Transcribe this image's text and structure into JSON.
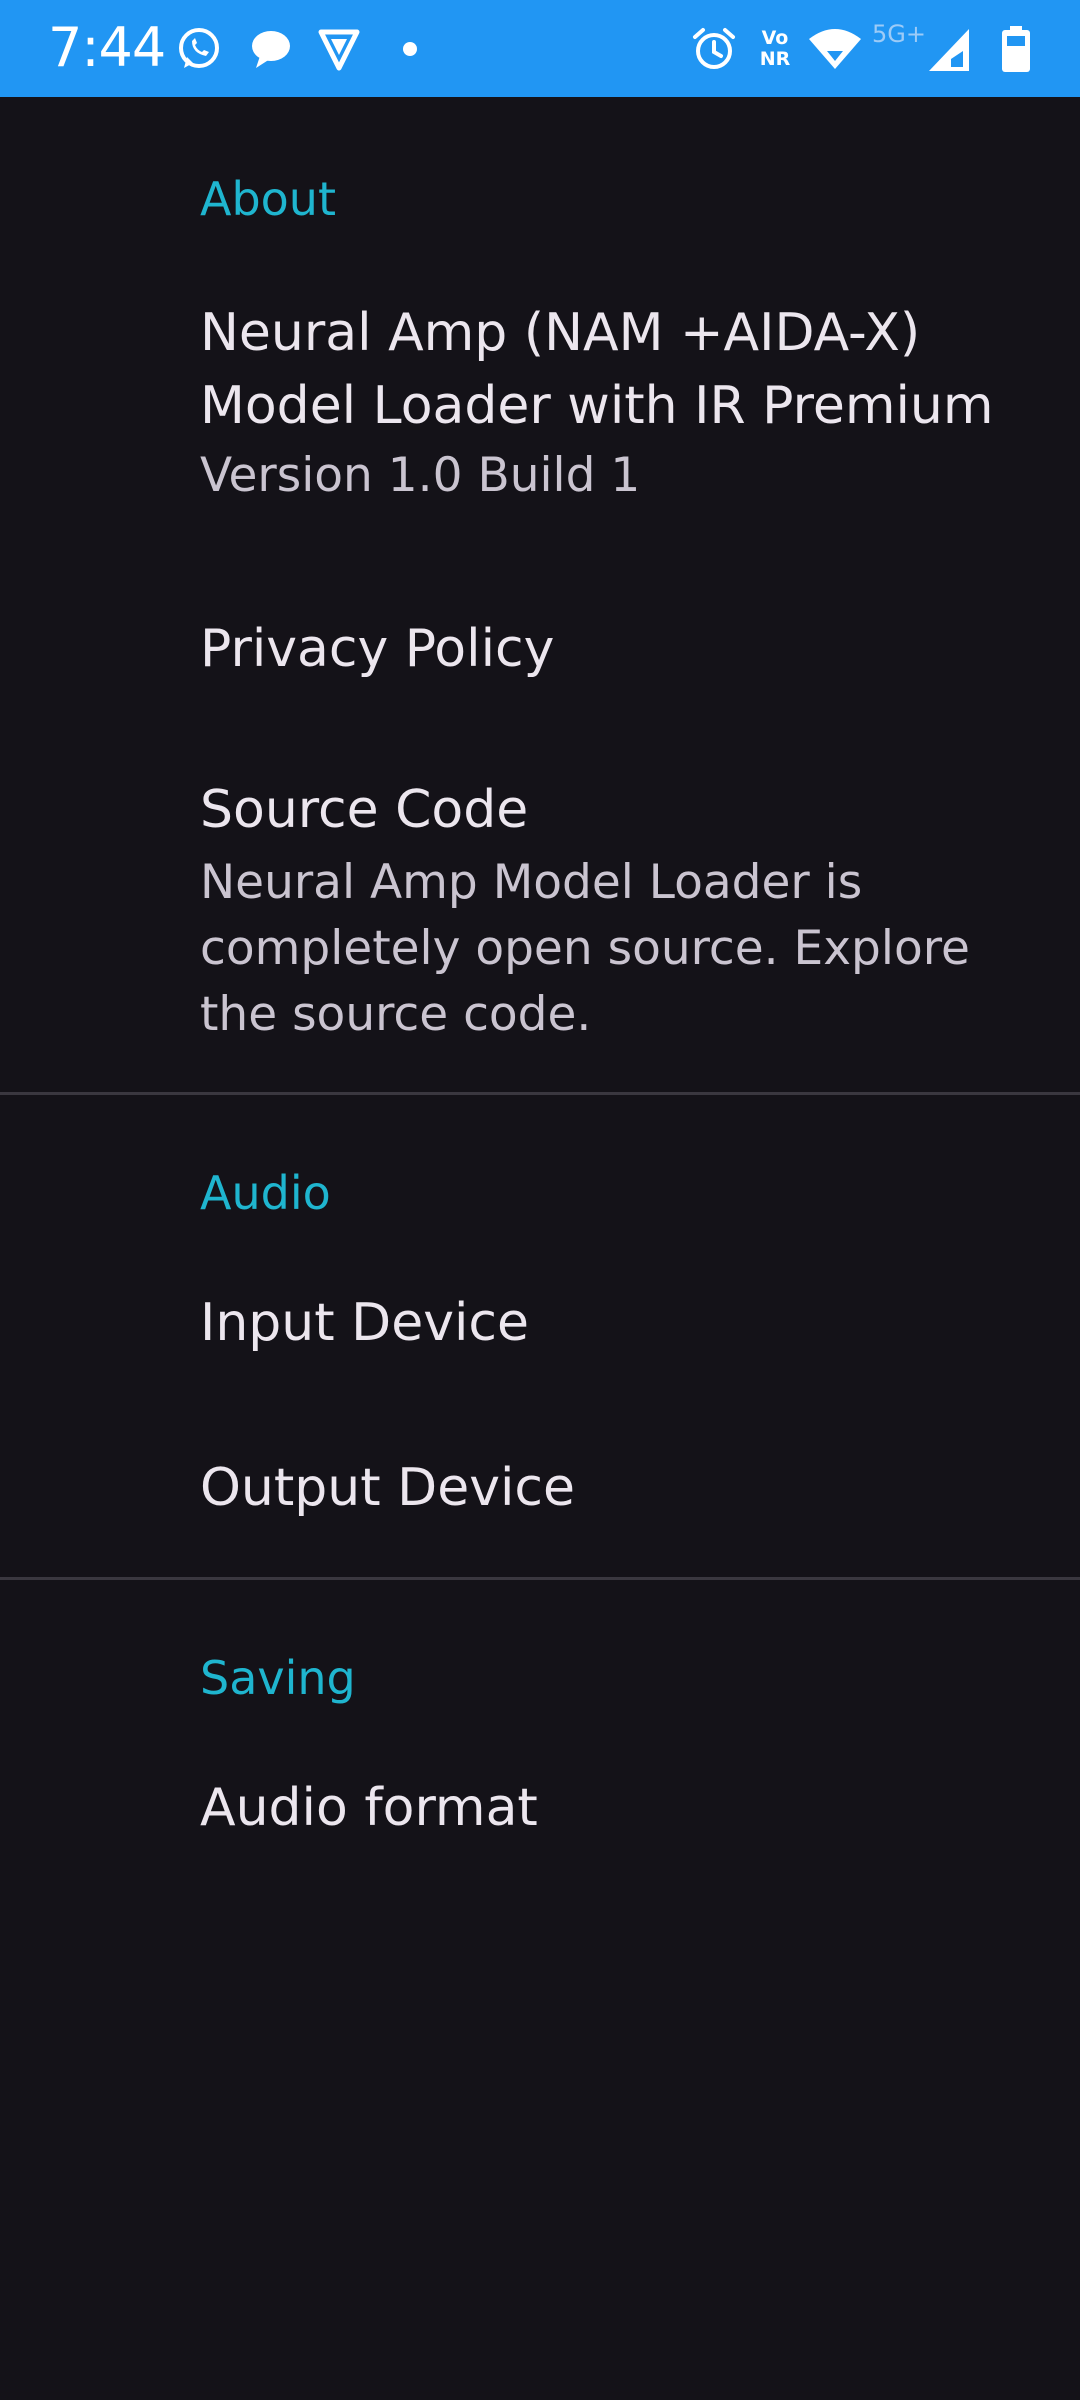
{
  "status_bar": {
    "time": "7:44",
    "volte_top": "Vo",
    "volte_bottom": "NR",
    "network_type": "5G+",
    "background_color": "#2196F3",
    "icons_left": [
      "whatsapp-icon",
      "chat-bubble-icon",
      "vpn-shield-icon",
      "dot-icon"
    ],
    "icons_right": [
      "alarm-icon",
      "volte-icon",
      "wifi-icon",
      "signal-icon",
      "battery-icon"
    ]
  },
  "colors": {
    "background": "#141218",
    "accent": "#1FB5CF",
    "text_primary": "#ECE6EE",
    "text_secondary": "#CAC4D0",
    "divider": "#3A373F"
  },
  "sections": {
    "about": {
      "header": "About",
      "app_title_line1": "Neural Amp (NAM +AIDA-X)",
      "app_title_line2": "Model Loader with IR Premium",
      "app_version": "Version 1.0 Build 1",
      "privacy_policy": "Privacy Policy",
      "source_code_title": "Source Code",
      "source_code_summary_line1": "Neural Amp Model Loader is",
      "source_code_summary_line2": "completely open source. Explore",
      "source_code_summary_line3": "the source code."
    },
    "audio": {
      "header": "Audio",
      "input_device": "Input Device",
      "output_device": "Output Device"
    },
    "saving": {
      "header": "Saving",
      "audio_format": "Audio format"
    }
  }
}
